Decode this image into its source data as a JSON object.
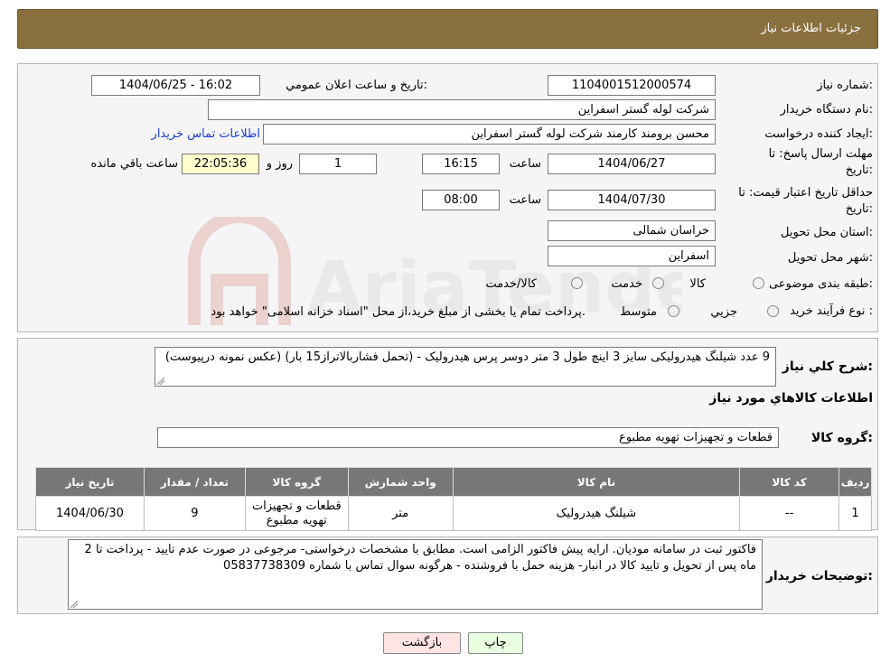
{
  "header": {
    "title": "جزئیات اطلاعات نیاز"
  },
  "form": {
    "need_number": {
      "label": "شماره نیاز:",
      "value": "1104001512000574"
    },
    "announce_datetime": {
      "label": "تاریخ و ساعت اعلان عمومي:",
      "value": "1404/06/25 - 16:02"
    },
    "buyer_org": {
      "label": "نام دستگاه خريدار:",
      "value": "شرکت لوله گستر اسفراين"
    },
    "requester": {
      "label": "ايجاد کننده درخواست:",
      "value": "محسن برومند کارمند شرکت لوله گستر اسفراين",
      "contact_link": "اطلاعات تماس خريدار"
    },
    "reply_deadline": {
      "label_line1": "مهلت ارسال پاسخ: تا",
      "label_line2": "تاريخ:",
      "date": "1404/06/27",
      "time_label": "ساعت",
      "time": "16:15",
      "days": "1",
      "days_label": "روز و",
      "remaining": "22:05:36",
      "remaining_label": "ساعت باقي مانده"
    },
    "price_validity": {
      "label_line1": "حداقل تاريخ اعتبار قيمت: تا",
      "label_line2": "تاريخ:",
      "date": "1404/07/30",
      "time_label": "ساعت",
      "time": "08:00"
    },
    "province": {
      "label": "استان محل تحويل:",
      "value": "خراسان شمالی"
    },
    "city": {
      "label": "شهر محل تحويل:",
      "value": "اسفراين"
    },
    "category": {
      "label": "طبقه بندی موضوعی:",
      "options": [
        "کالا",
        "خدمت",
        "کالا/خدمت"
      ]
    },
    "process": {
      "label": "نوع فرآيند خريد :",
      "options": [
        "جزيي",
        "متوسط"
      ],
      "note": "پرداخت تمام يا بخشی از مبلغ خريد،از محل \"اسناد خزانه اسلامی\" خواهد بود."
    }
  },
  "watermark": {
    "text": "AriaTender.neT"
  },
  "summary": {
    "label": "شرح کلي نياز:",
    "text": "9 عدد شیلنگ هیدرولیکی سایز 3 اینچ  طول 3 متر دوسر پرس هیدرولیک - (تحمل فشاربالاتراز15 بار) (عکس نمونه درپیوست)"
  },
  "goods_info": {
    "title": "اطلاعات کالاهاي مورد نياز"
  },
  "goods_group": {
    "label": "گروه کالا:",
    "value": "قطعات و تجهیزات تهویه مطبوع"
  },
  "table": {
    "headers": [
      "رديف",
      "کد کالا",
      "نام کالا",
      "واحد شمارش",
      "گروه کالا",
      "تعداد / مقدار",
      "تاريخ نياز"
    ],
    "rows": [
      {
        "row": "1",
        "code": "--",
        "name": "شیلنگ هیدرولیک",
        "unit": "متر",
        "group": "قطعات و تجهیزات تهویه مطبوع",
        "qty": "9",
        "date": "1404/06/30"
      }
    ]
  },
  "buyer_notes": {
    "label": "توضيحات خريدار:",
    "text": "فاکتور ثبت در سامانه مودیان. ارایه پیش فاکتور الزامی است. مطابق با مشخصات درخواستی- مرجوعی در صورت عدم تایید - پرداخت تا 2 ماه پس از تحویل و تایید کالا در انبار- هزینه حمل با فروشنده - هرگونه سوال تماس با شماره 05837738309"
  },
  "buttons": {
    "print": "چاپ",
    "back": "بازگشت"
  },
  "colors": {
    "header_bg": "#8a6f3f",
    "table_header_bg": "#777777",
    "back_button_bg": "#ffe4e4",
    "print_button_bg": "#e8ffe0",
    "remaining_bg": "#ffffcc"
  }
}
